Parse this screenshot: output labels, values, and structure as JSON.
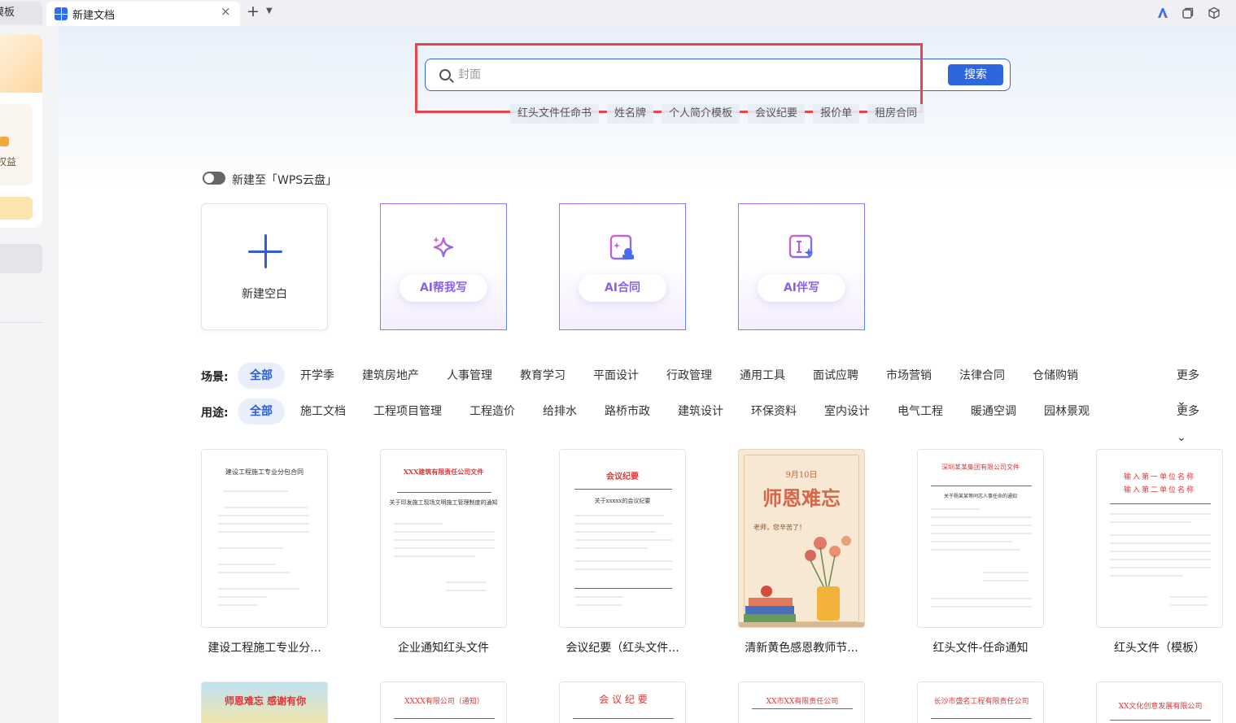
{
  "tabs": {
    "prev_label": "模板",
    "active_title": "新建文档",
    "close": "×",
    "add": "+",
    "dropdown": "⌄"
  },
  "sidebar": {
    "rights_label": "权益"
  },
  "search": {
    "placeholder": "封面",
    "button_label": "搜索",
    "hot_tags": [
      "红头文件任命书",
      "姓名牌",
      "个人简介模板",
      "会议纪要",
      "报价单",
      "租房合同"
    ]
  },
  "toggle_label": "新建至「WPS云盘」",
  "create_cards": {
    "blank_label": "新建空白",
    "ai_cards": [
      {
        "label": "AI帮我写",
        "icon": "sparkle-icon"
      },
      {
        "label": "AI合同",
        "icon": "contract-stamp-icon"
      },
      {
        "label": "AI伴写",
        "icon": "text-cursor-sparkle-icon"
      }
    ]
  },
  "filters": {
    "scene_label": "场景:",
    "scene_items": [
      "全部",
      "开学季",
      "建筑房地产",
      "人事管理",
      "教育学习",
      "平面设计",
      "行政管理",
      "通用工具",
      "面试应聘",
      "市场营销",
      "法律合同",
      "仓储购销"
    ],
    "usage_label": "用途:",
    "usage_items": [
      "全部",
      "施工文档",
      "工程项目管理",
      "工程造价",
      "给排水",
      "路桥市政",
      "建筑设计",
      "环保资料",
      "室内设计",
      "电气工程",
      "暖通空调",
      "园林景观"
    ],
    "more_label": "更多 ⌄"
  },
  "templates": [
    {
      "title": "建设工程施工专业分...",
      "thumb_heading": "建设工程施工专业分包合同"
    },
    {
      "title": "企业通知红头文件",
      "thumb_heading": "XXX建筑有限责任公司文件",
      "thumb_sub": "关于印发施工现场文明施工管理制度的通知"
    },
    {
      "title": "会议纪要（红头文件...",
      "thumb_heading": "会议纪要",
      "thumb_sub": "关于xxxxx的会议纪要"
    },
    {
      "title": "清新黄色感恩教师节...",
      "thumb_date": "9月10日",
      "thumb_heading": "师恩难忘",
      "thumb_sub": "老师，您辛苦了！"
    },
    {
      "title": "红头文件-任命通知",
      "thumb_heading": "深圳某某集团有限公司文件",
      "thumb_sub": "关于杨某某等同志人事任命的通知"
    },
    {
      "title": "红头文件（模板）",
      "thumb_heading": "输入第一单位名称",
      "thumb_heading2": "输入第二单位名称"
    }
  ],
  "templates_row2": [
    {
      "thumb_heading": "师恩难忘 感谢有你"
    },
    {
      "thumb_heading": "XXXX有限公司（通知）"
    },
    {
      "thumb_heading": "会 议 纪 要"
    },
    {
      "thumb_heading": "XX市XX有限责任公司"
    },
    {
      "thumb_heading": "长沙市盛名工程有限责任公司"
    },
    {
      "thumb_heading": "XX文化创意发展有限公司"
    }
  ]
}
